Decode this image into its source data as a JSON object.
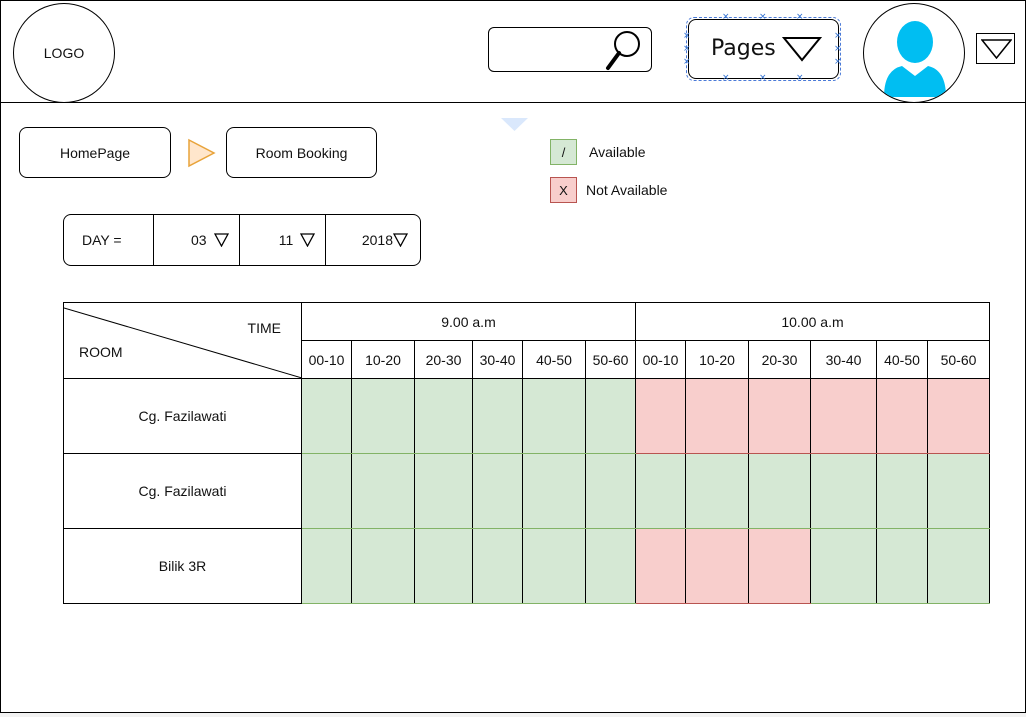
{
  "header": {
    "logo_text": "LOGO",
    "search": {
      "value": "",
      "icon": "search-icon"
    },
    "pages_menu": {
      "label": "Pages",
      "icon": "chevron-down-icon"
    },
    "avatar_icon": "user-avatar-icon",
    "account_menu_icon": "chevron-down-icon"
  },
  "breadcrumb": {
    "items": [
      {
        "label": "HomePage"
      },
      {
        "label": "Room Booking"
      }
    ],
    "separator_icon": "arrow-right-icon"
  },
  "legend": [
    {
      "symbol": "/",
      "label": "Available",
      "color": "#d5e8d4"
    },
    {
      "symbol": "X",
      "label": "Not Available",
      "color": "#f8cecc"
    }
  ],
  "date_filter": {
    "label": "DAY =",
    "day": "03",
    "month": "11",
    "year": "2018"
  },
  "schedule": {
    "corner": {
      "time_label": "TIME",
      "room_label": "ROOM"
    },
    "hours": [
      "9.00 a.m",
      "10.00 a.m"
    ],
    "slots": [
      "00-10",
      "10-20",
      "20-30",
      "30-40",
      "40-50",
      "50-60"
    ],
    "rooms": [
      {
        "name": "Cg. Fazilawati",
        "availability": [
          "available",
          "available",
          "available",
          "available",
          "available",
          "available",
          "not-available",
          "not-available",
          "not-available",
          "not-available",
          "not-available",
          "not-available"
        ]
      },
      {
        "name": "Cg. Fazilawati",
        "availability": [
          "available",
          "available",
          "available",
          "available",
          "available",
          "available",
          "available",
          "available",
          "available",
          "available",
          "available",
          "available"
        ]
      },
      {
        "name": "Bilik 3R",
        "availability": [
          "available",
          "available",
          "available",
          "available",
          "available",
          "available",
          "not-available",
          "not-available",
          "not-available",
          "available",
          "available",
          "available"
        ]
      }
    ]
  }
}
